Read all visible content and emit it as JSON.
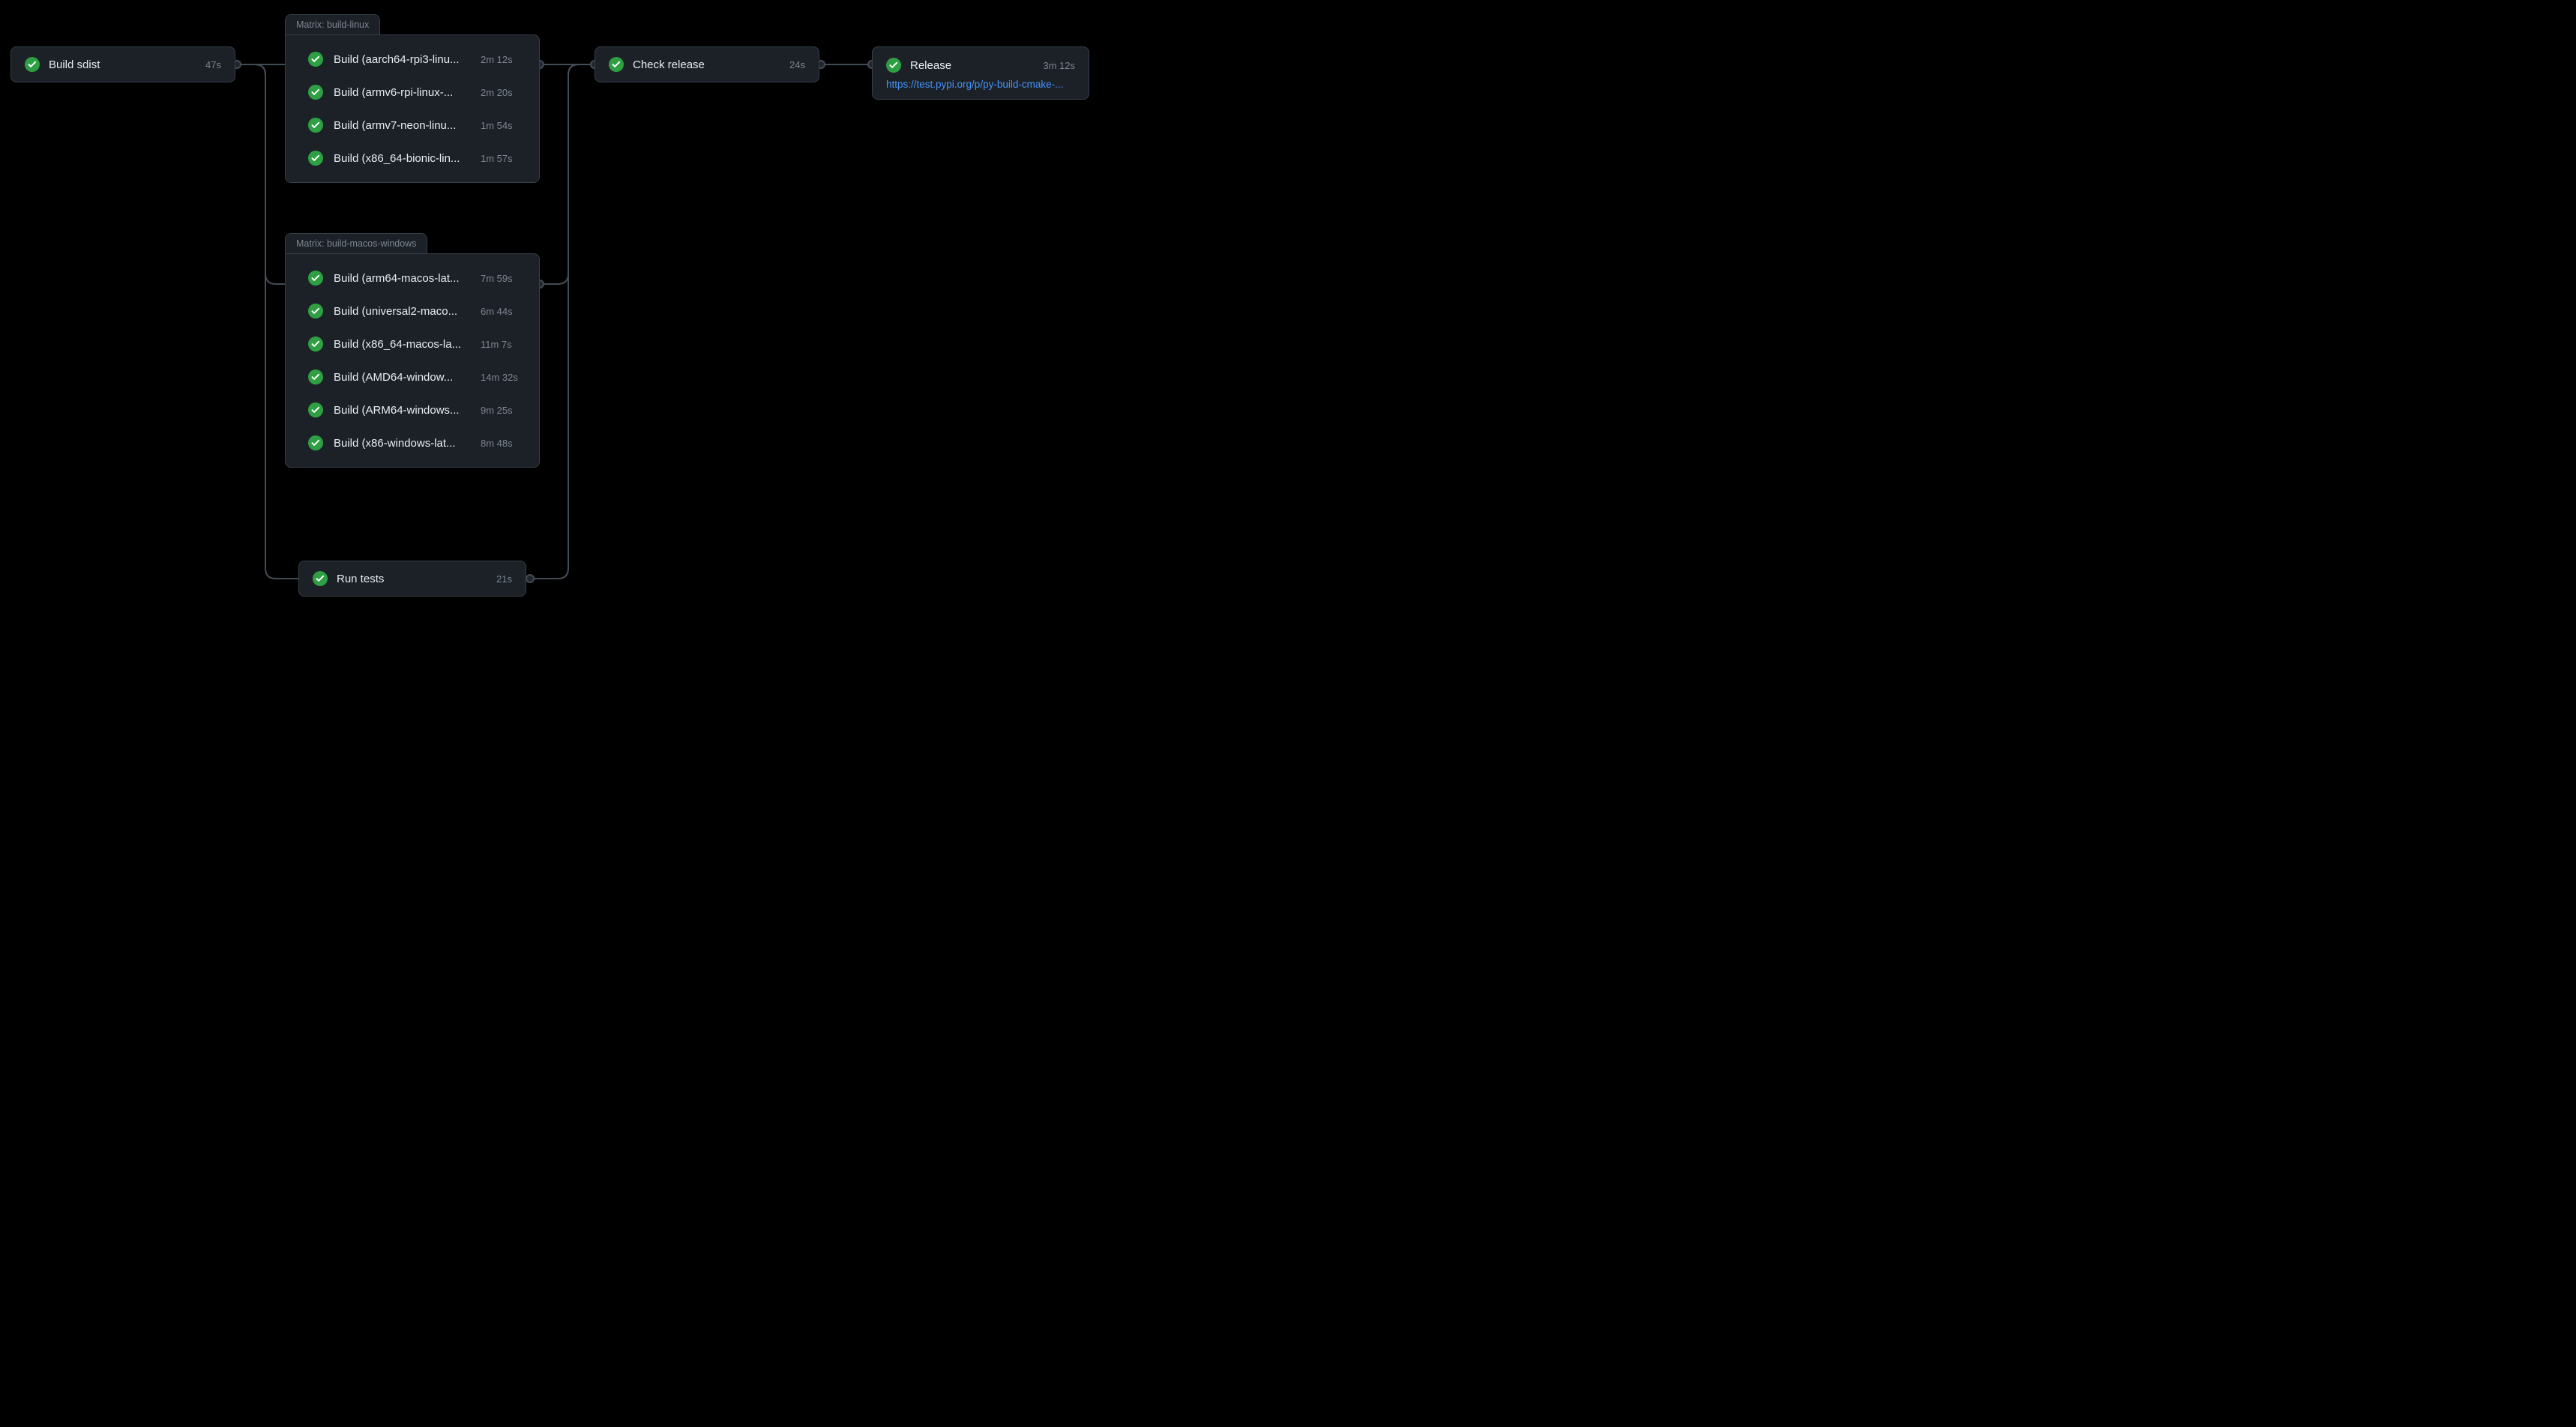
{
  "build_sdist": {
    "label": "Build sdist",
    "duration": "47s"
  },
  "matrix_linux": {
    "title": "Matrix: build-linux",
    "jobs": [
      {
        "label": "Build (aarch64-rpi3-linu...",
        "duration": "2m 12s"
      },
      {
        "label": "Build (armv6-rpi-linux-...",
        "duration": "2m 20s"
      },
      {
        "label": "Build (armv7-neon-linu...",
        "duration": "1m 54s"
      },
      {
        "label": "Build (x86_64-bionic-lin...",
        "duration": "1m 57s"
      }
    ]
  },
  "matrix_macos": {
    "title": "Matrix: build-macos-windows",
    "jobs": [
      {
        "label": "Build (arm64-macos-lat...",
        "duration": "7m 59s"
      },
      {
        "label": "Build (universal2-maco...",
        "duration": "6m 44s"
      },
      {
        "label": "Build (x86_64-macos-la...",
        "duration": "11m 7s"
      },
      {
        "label": "Build (AMD64-window...",
        "duration": "14m 32s"
      },
      {
        "label": "Build (ARM64-windows...",
        "duration": "9m 25s"
      },
      {
        "label": "Build (x86-windows-lat...",
        "duration": "8m 48s"
      }
    ]
  },
  "run_tests": {
    "label": "Run tests",
    "duration": "21s"
  },
  "check_release": {
    "label": "Check release",
    "duration": "24s"
  },
  "release": {
    "label": "Release",
    "duration": "3m 12s",
    "link": "https://test.pypi.org/p/py-build-cmake-..."
  }
}
